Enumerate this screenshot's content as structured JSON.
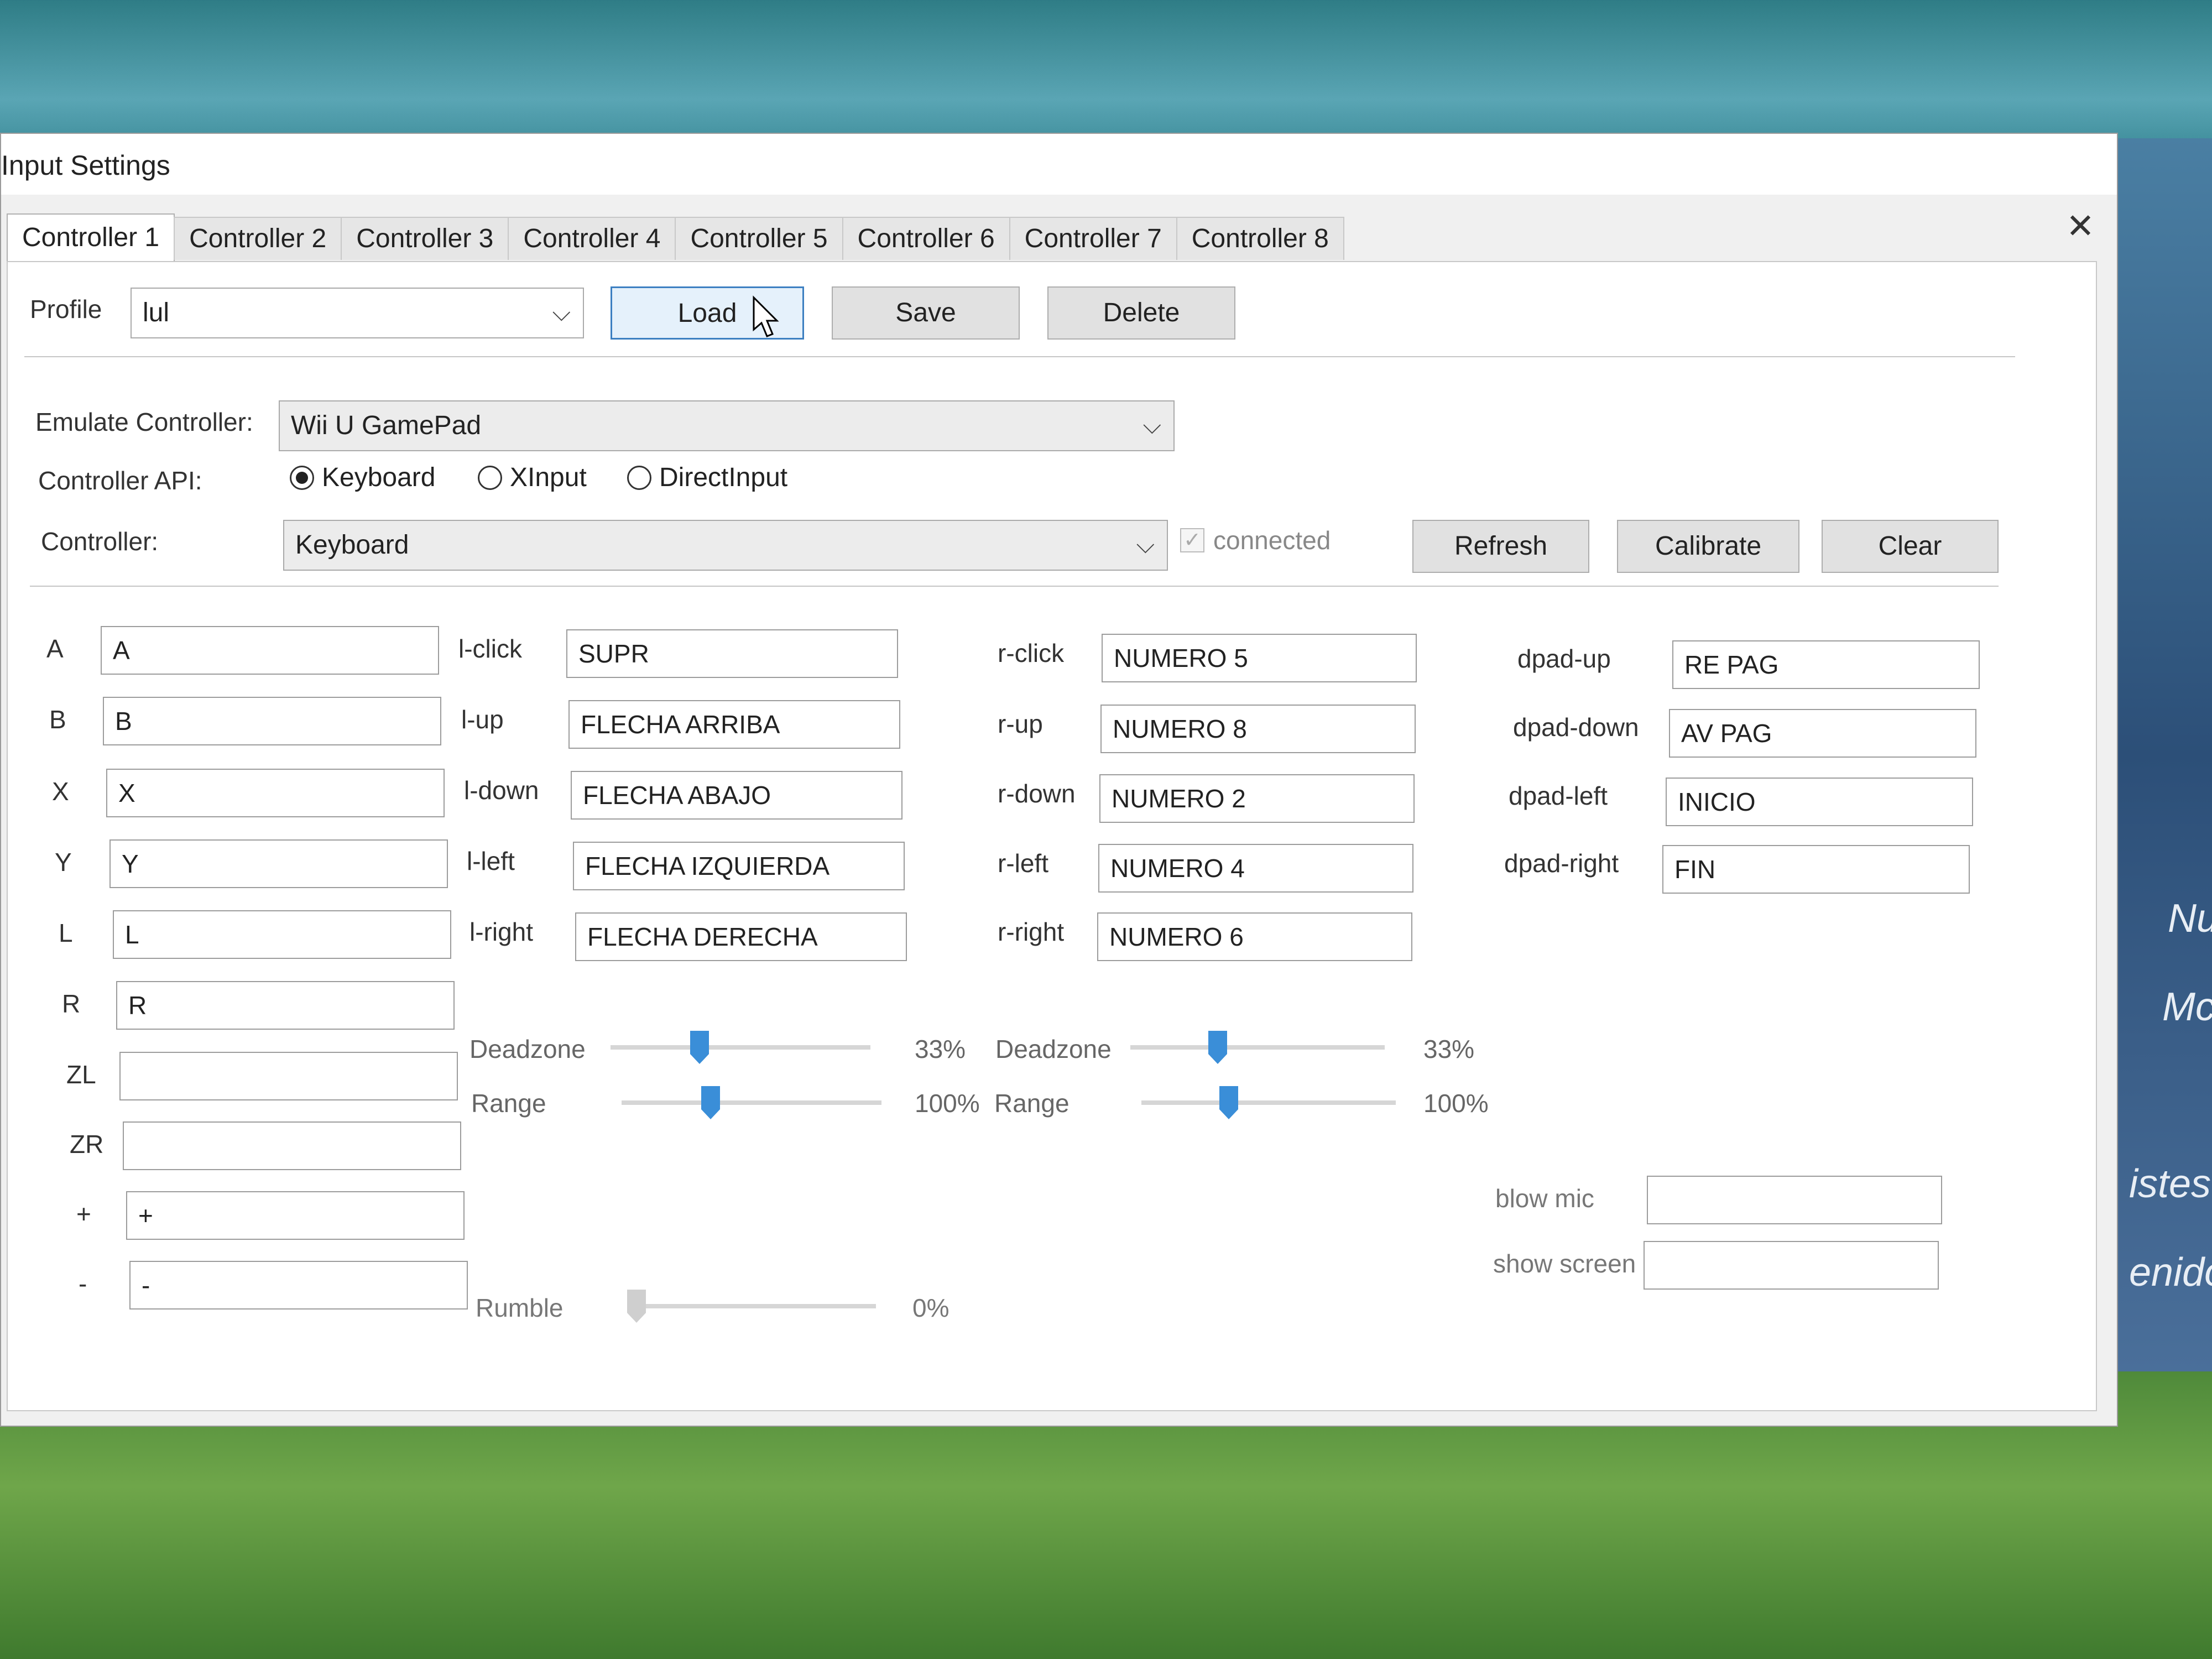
{
  "window": {
    "title": "Input Settings"
  },
  "tabs": [
    "Controller 1",
    "Controller 2",
    "Controller 3",
    "Controller 4",
    "Controller 5",
    "Controller 6",
    "Controller 7",
    "Controller 8"
  ],
  "profile": {
    "label": "Profile",
    "value": "lul",
    "load": "Load",
    "save": "Save",
    "delete": "Delete"
  },
  "emulate": {
    "label": "Emulate Controller:",
    "value": "Wii U GamePad"
  },
  "api": {
    "label": "Controller API:",
    "options": [
      "Keyboard",
      "XInput",
      "DirectInput"
    ],
    "selected": "Keyboard"
  },
  "controller": {
    "label": "Controller:",
    "value": "Keyboard",
    "connected": "connected",
    "refresh": "Refresh",
    "calibrate": "Calibrate",
    "clear": "Clear"
  },
  "buttons": [
    {
      "label": "A",
      "value": "A"
    },
    {
      "label": "B",
      "value": "B"
    },
    {
      "label": "X",
      "value": "X"
    },
    {
      "label": "Y",
      "value": "Y"
    },
    {
      "label": "L",
      "value": "L"
    },
    {
      "label": "R",
      "value": "R"
    },
    {
      "label": "ZL",
      "value": ""
    },
    {
      "label": "ZR",
      "value": ""
    },
    {
      "label": "+",
      "value": "+"
    },
    {
      "label": "-",
      "value": "-"
    }
  ],
  "left_stick": [
    {
      "label": "l-click",
      "value": "SUPR"
    },
    {
      "label": "l-up",
      "value": "FLECHA ARRIBA"
    },
    {
      "label": "l-down",
      "value": "FLECHA ABAJO"
    },
    {
      "label": "l-left",
      "value": "FLECHA IZQUIERDA"
    },
    {
      "label": "l-right",
      "value": "FLECHA DERECHA"
    }
  ],
  "right_stick": [
    {
      "label": "r-click",
      "value": "NUMERO 5"
    },
    {
      "label": "r-up",
      "value": "NUMERO 8"
    },
    {
      "label": "r-down",
      "value": "NUMERO 2"
    },
    {
      "label": "r-left",
      "value": "NUMERO 4"
    },
    {
      "label": "r-right",
      "value": "NUMERO 6"
    }
  ],
  "dpad": [
    {
      "label": "dpad-up",
      "value": "RE PAG"
    },
    {
      "label": "dpad-down",
      "value": "AV PAG"
    },
    {
      "label": "dpad-left",
      "value": "INICIO"
    },
    {
      "label": "dpad-right",
      "value": "FIN"
    }
  ],
  "left_sliders": {
    "deadzone": {
      "label": "Deadzone",
      "value": "33%",
      "fraction": 0.33
    },
    "range": {
      "label": "Range",
      "value": "100%",
      "fraction": 0.33
    }
  },
  "right_sliders": {
    "deadzone": {
      "label": "Deadzone",
      "value": "33%",
      "fraction": 0.33
    },
    "range": {
      "label": "Range",
      "value": "100%",
      "fraction": 0.33
    }
  },
  "rumble": {
    "label": "Rumble",
    "value": "0%",
    "fraction": 0
  },
  "extra": [
    {
      "label": "blow mic",
      "value": ""
    },
    {
      "label": "show screen",
      "value": ""
    }
  ],
  "background": {
    "side_texts": [
      "Nu",
      "Mc",
      "istes",
      "enido"
    ]
  }
}
